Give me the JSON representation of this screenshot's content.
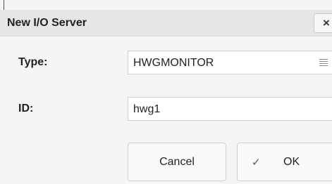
{
  "dialog": {
    "title": "New I/O Server",
    "close_label": "×"
  },
  "fields": {
    "type": {
      "label": "Type:",
      "value": "HWGMONITOR",
      "icon": "list-menu-icon"
    },
    "id": {
      "label": "ID:",
      "value": "hwg1"
    }
  },
  "buttons": {
    "cancel_label": "Cancel",
    "ok_label": "OK",
    "ok_icon": "✓"
  }
}
